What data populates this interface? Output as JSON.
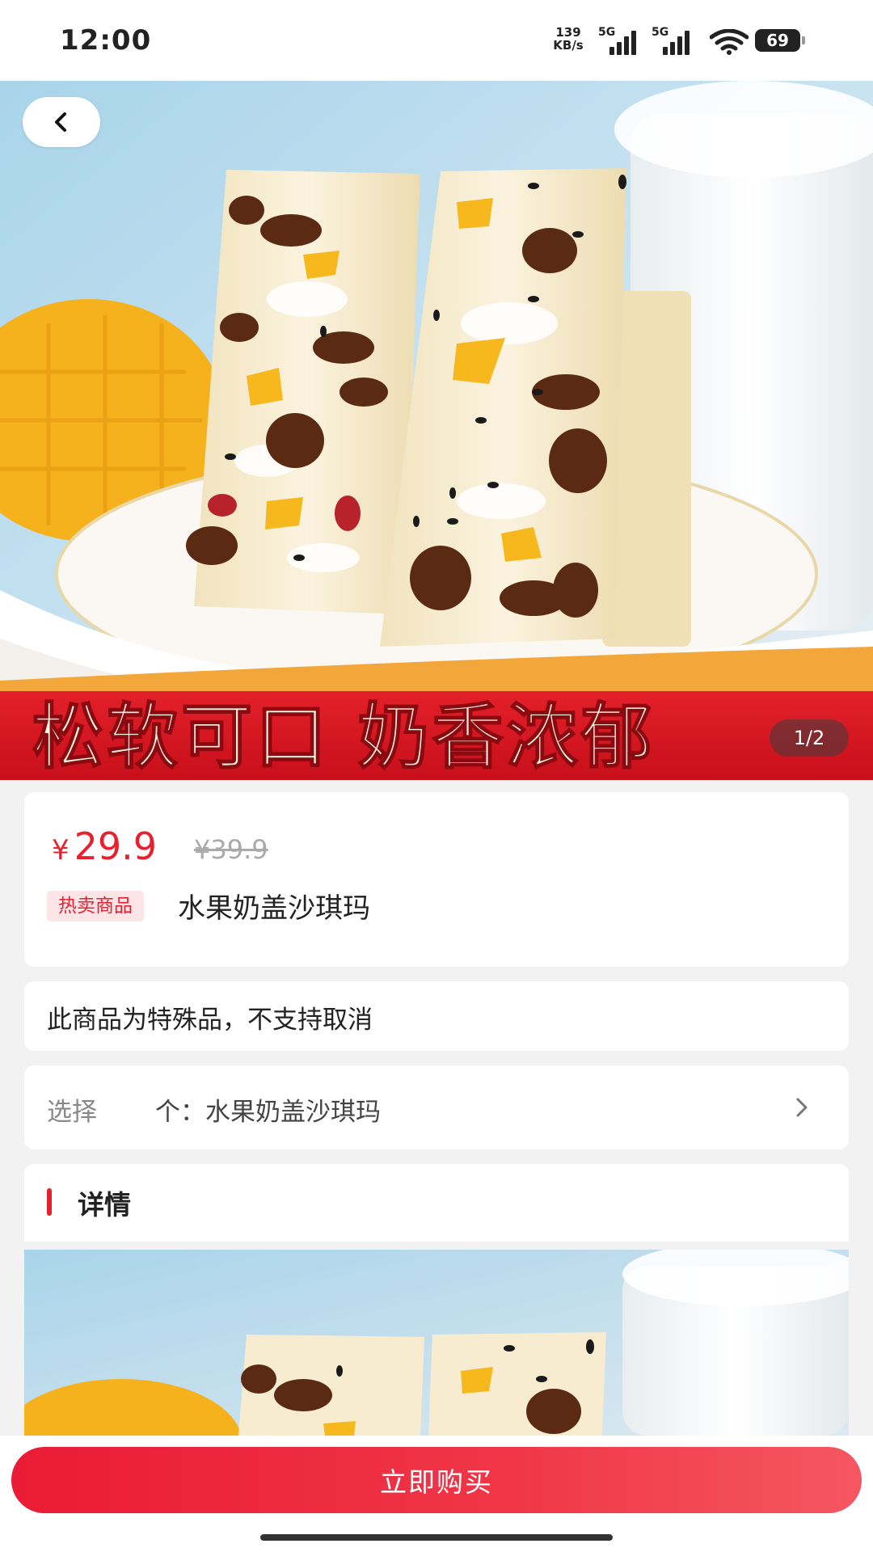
{
  "status_bar": {
    "time": "12:00",
    "net_speed_value": "139",
    "net_speed_unit": "KB/s",
    "sim1_label": "5G",
    "sim2_label": "5G",
    "battery_level": "69"
  },
  "hero": {
    "banner_text": "松软可口 奶香浓郁",
    "page_indicator": "1/2"
  },
  "product": {
    "currency": "¥",
    "price": "29.9",
    "original_price": "¥39.9",
    "tag": "热卖商品",
    "name": "水果奶盖沙琪玛"
  },
  "notice": {
    "text": "此商品为特殊品，不支持取消"
  },
  "selection": {
    "label": "选择",
    "value": "个：水果奶盖沙琪玛"
  },
  "details": {
    "title": "详情"
  },
  "action": {
    "buy_label": "立即购买"
  },
  "colors": {
    "accent": "#e8202e",
    "tag_bg": "#fde4e6",
    "banner_red": "#d8161f"
  }
}
